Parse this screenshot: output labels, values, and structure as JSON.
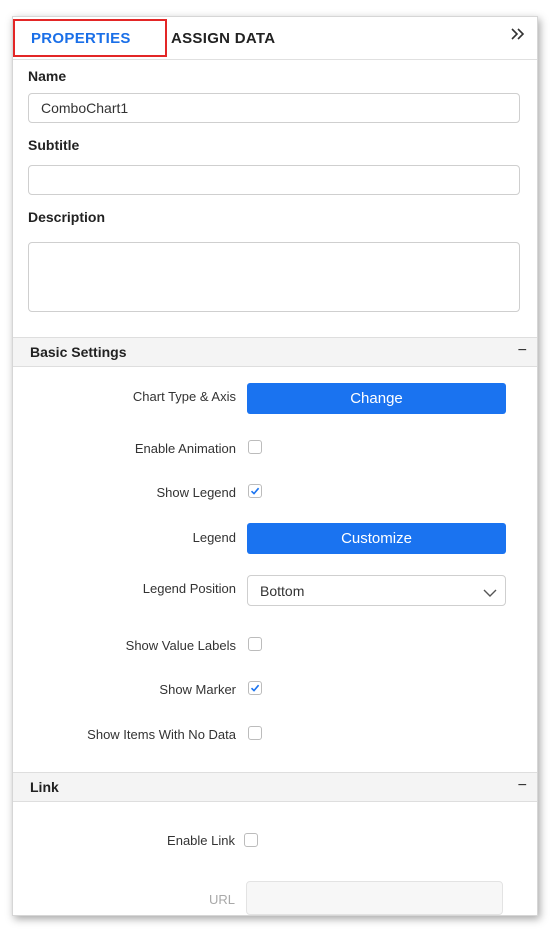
{
  "tabs": {
    "properties_label": "PROPERTIES",
    "assign_data_label": "ASSIGN DATA"
  },
  "general": {
    "name_label": "Name",
    "name_value": "ComboChart1",
    "subtitle_label": "Subtitle",
    "subtitle_value": "",
    "description_label": "Description",
    "description_value": ""
  },
  "basic_settings": {
    "title": "Basic Settings",
    "toggle": "−",
    "chart_type_label": "Chart Type & Axis",
    "change_button": "Change",
    "enable_animation_label": "Enable Animation",
    "enable_animation_checked": false,
    "show_legend_label": "Show Legend",
    "show_legend_checked": true,
    "legend_label": "Legend",
    "customize_button": "Customize",
    "legend_position_label": "Legend Position",
    "legend_position_value": "Bottom",
    "show_value_labels_label": "Show Value Labels",
    "show_value_labels_checked": false,
    "show_marker_label": "Show Marker",
    "show_marker_checked": true,
    "show_items_no_data_label": "Show Items With No Data",
    "show_items_no_data_checked": false
  },
  "link": {
    "title": "Link",
    "toggle": "−",
    "enable_link_label": "Enable Link",
    "enable_link_checked": false,
    "url_label": "URL",
    "url_value": ""
  },
  "colors": {
    "accent": "#1a73f0",
    "tab_active": "#1a6fe8",
    "highlight": "#e32626"
  }
}
